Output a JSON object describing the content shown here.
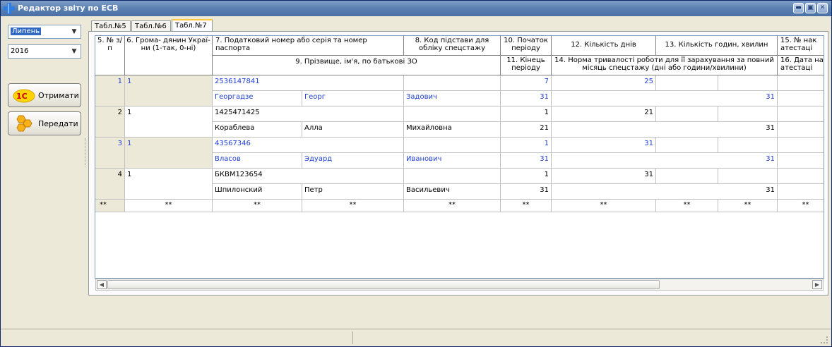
{
  "window": {
    "title": "Редактор звіту по ЕСВ"
  },
  "left": {
    "month": "Липень",
    "year": "2016",
    "get_label": "Отримати",
    "send_label": "Передати"
  },
  "tabs": [
    "Табл.№5",
    "Табл.№6",
    "Табл.№7"
  ],
  "grid": {
    "headers": {
      "h5": "5. № з/п",
      "h6": "6. Грома- дянин Украї- ни (1-так, 0-ні)",
      "h7": "7. Податковий номер або серія та номер паспорта",
      "h8": "8. Код підстави для обліку спецстажу",
      "h10": "10. Початок періоду",
      "h12": "12. Кількість днів",
      "h13": "13. Кількість годин, хвилин",
      "h15": "15. № нак атестаці",
      "h9": "9. Прізвище, ім'я, по батькові ЗО",
      "h11": "11. Кінець періоду",
      "h14": "14. Норма тривалості роботи для її зарахування за повний місяць спецстажу (дні або години/хвилини)",
      "h16": "16. Дата на атестаці"
    },
    "rows": [
      {
        "n": "1",
        "citizen": "1",
        "tax": "2536147841",
        "surname": "Георгадзе",
        "name": "Георг",
        "patronymic": "Задович",
        "start": "7",
        "end": "31",
        "days": "25",
        "norm": "31",
        "blue": true
      },
      {
        "n": "2",
        "citizen": "1",
        "tax": "1425471425",
        "surname": "Кораблева",
        "name": "Алла",
        "patronymic": "Михайловна",
        "start": "1",
        "end": "21",
        "days": "21",
        "norm": "31",
        "blue": false
      },
      {
        "n": "3",
        "citizen": "1",
        "tax": "43567346",
        "surname": "Власов",
        "name": "Эдуард",
        "patronymic": "Иванович",
        "start": "1",
        "end": "31",
        "days": "31",
        "norm": "31",
        "blue": true
      },
      {
        "n": "4",
        "citizen": "1",
        "tax": "БКВМ123654",
        "surname": "Шпилонский",
        "name": "Петр",
        "patronymic": "Васильевич",
        "start": "1",
        "end": "31",
        "days": "31",
        "norm": "31",
        "blue": false
      }
    ],
    "total_marker": "**"
  }
}
